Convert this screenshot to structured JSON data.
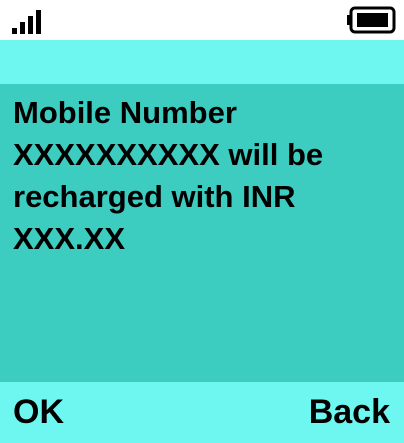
{
  "status_bar": {
    "signal_icon": "signal-strength-icon",
    "signal_level": "4/4",
    "battery_icon": "battery-icon",
    "battery_level": "full"
  },
  "message": {
    "text": "Mobile Number\nXXXXXXXXXX will be\nrecharged with INR\nXXX.XX"
  },
  "softkeys": {
    "left_label": "OK",
    "right_label": "Back"
  },
  "colors": {
    "header_band": "#6ef7f1",
    "content_background": "#3ccdc0",
    "softkey_bar": "#6ef7f1"
  }
}
